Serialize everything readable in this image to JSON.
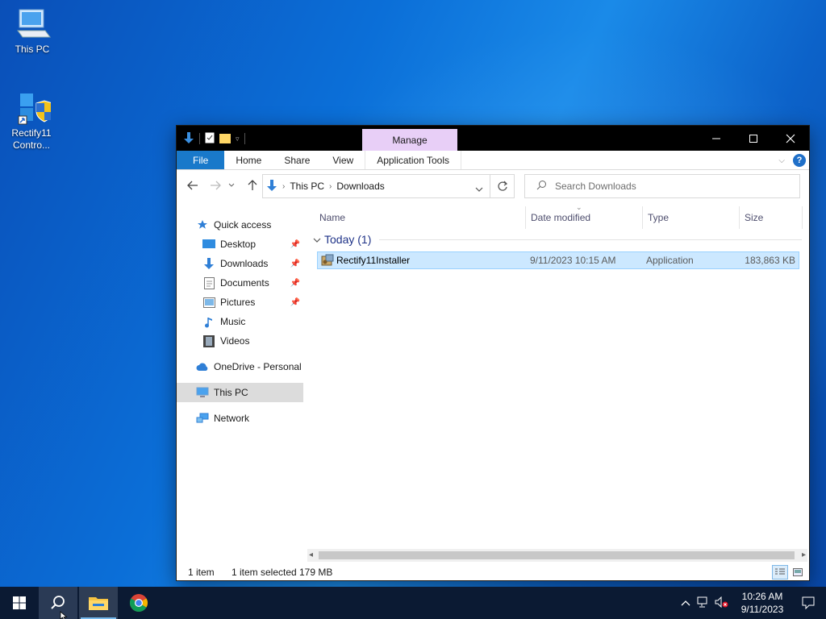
{
  "desktop": {
    "icons": [
      {
        "label": "This PC",
        "icon": "computer-icon"
      },
      {
        "label": "Rectify11 Contro...",
        "icon": "rectify11-control-panel-icon"
      }
    ]
  },
  "window": {
    "contextual_tab": "Manage",
    "ribbon_tabs": [
      "File",
      "Home",
      "Share",
      "View",
      "Application Tools"
    ],
    "address": {
      "crumbs": [
        "This PC",
        "Downloads"
      ]
    },
    "search": {
      "placeholder": "Search Downloads"
    },
    "nav": {
      "quick_access": "Quick access",
      "items": [
        "Desktop",
        "Downloads",
        "Documents",
        "Pictures",
        "Music",
        "Videos"
      ],
      "onedrive": "OneDrive - Personal",
      "this_pc": "This PC",
      "network": "Network"
    },
    "columns": {
      "name": "Name",
      "date": "Date modified",
      "type": "Type",
      "size": "Size"
    },
    "group": {
      "label": "Today (1)"
    },
    "files": [
      {
        "name": "Rectify11Installer",
        "date": "9/11/2023 10:15 AM",
        "type": "Application",
        "size": "183,863 KB",
        "selected": true
      }
    ],
    "status": {
      "count": "1 item",
      "selected": "1 item selected",
      "size": "179 MB"
    }
  },
  "taskbar": {
    "clock": {
      "time": "10:26 AM",
      "date": "9/11/2023"
    },
    "apps": [
      "start",
      "search",
      "file-explorer",
      "chrome"
    ],
    "active_app": "file-explorer"
  },
  "colors": {
    "accent": "#1979ca",
    "selection": "#cce8ff",
    "manage_tab": "#e8cff7",
    "taskbar": "#0b1a33"
  }
}
